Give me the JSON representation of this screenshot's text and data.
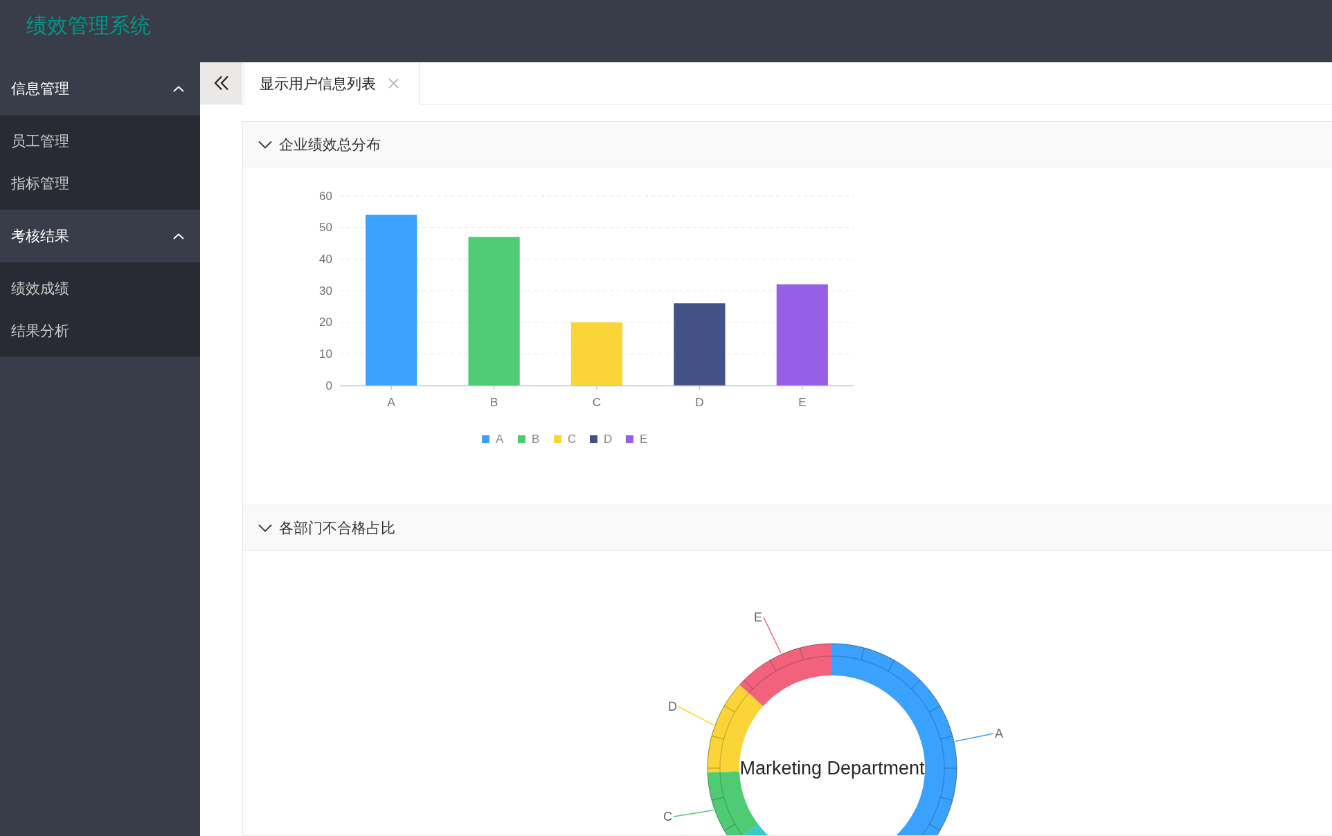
{
  "header": {
    "title": "绩效管理系统"
  },
  "sidebar": {
    "groups": [
      {
        "label": "信息管理",
        "expanded": true,
        "items": [
          {
            "label": "员工管理",
            "selected": false
          },
          {
            "label": "指标管理",
            "selected": false
          }
        ]
      },
      {
        "label": "考核结果",
        "expanded": true,
        "items": [
          {
            "label": "绩效成绩",
            "selected": false
          },
          {
            "label": "结果分析",
            "selected": false
          }
        ]
      }
    ]
  },
  "tabs": [
    {
      "label": "显示用户信息列表",
      "selected": true
    }
  ],
  "panels": [
    {
      "title": "企业绩效总分布",
      "expanded": true,
      "kind": "bar_chart",
      "chart_data": {
        "type": "bar",
        "categories": [
          "A",
          "B",
          "C",
          "D",
          "E"
        ],
        "series": [
          {
            "name": "A",
            "color": "#3aa1ff",
            "values": [
              54,
              null,
              null,
              null,
              null
            ]
          },
          {
            "name": "B",
            "color": "#4ecb73",
            "values": [
              null,
              47,
              null,
              null,
              null
            ]
          },
          {
            "name": "C",
            "color": "#fbd437",
            "values": [
              null,
              null,
              20,
              null,
              null
            ]
          },
          {
            "name": "D",
            "color": "#435188",
            "values": [
              null,
              null,
              null,
              26,
              null
            ]
          },
          {
            "name": "E",
            "color": "#975fe5",
            "values": [
              null,
              null,
              null,
              null,
              32
            ]
          }
        ],
        "stacked": true,
        "ylim": [
          0,
          60
        ],
        "yticks": [
          0,
          10,
          20,
          30,
          40,
          50,
          60
        ],
        "grid": true,
        "legend": true
      }
    },
    {
      "title": "各部门不合格占比",
      "expanded": true,
      "kind": "ring_chart",
      "ring": {
        "center_label": "Marketing Department",
        "slices": [
          {
            "label": "A",
            "color": "#3aa1ff"
          },
          {
            "color": "#36cbcb"
          },
          {
            "label": "C",
            "color": "#4ecb73"
          },
          {
            "label": "D",
            "color": "#fbd437"
          },
          {
            "label": "E",
            "color": "#f2637b"
          }
        ]
      }
    }
  ]
}
